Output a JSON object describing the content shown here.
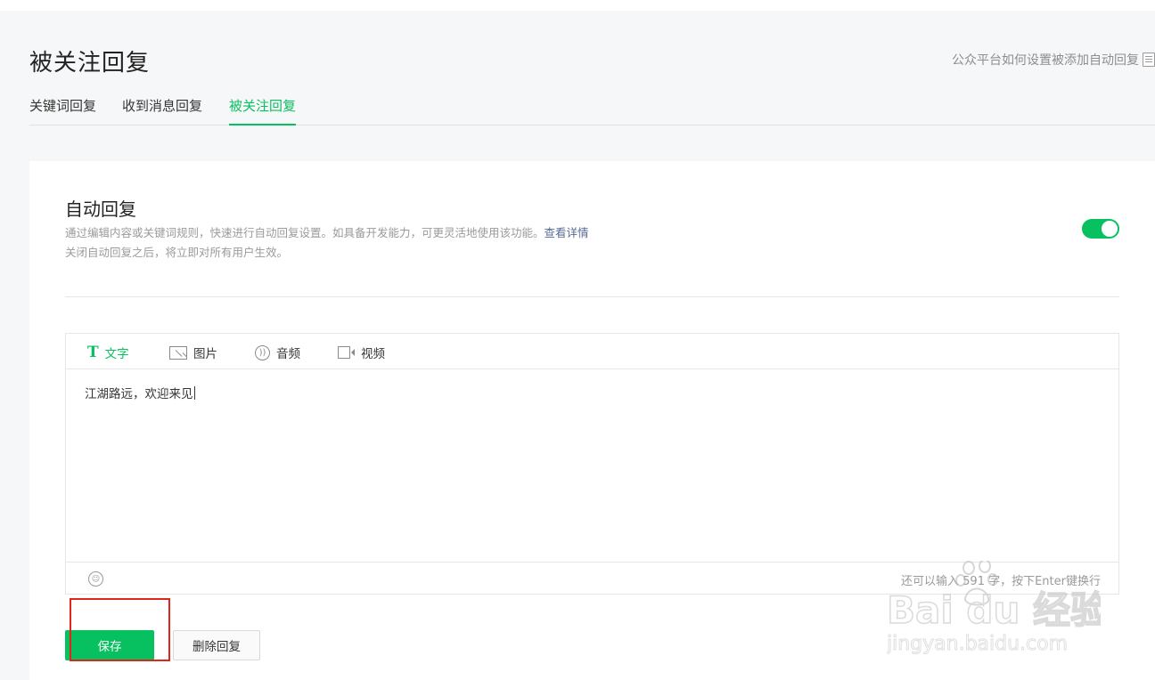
{
  "header": {
    "title": "被关注回复",
    "help_link": "公众平台如何设置被添加自动回复"
  },
  "tabs": [
    {
      "label": "关键词回复",
      "active": false
    },
    {
      "label": "收到消息回复",
      "active": false
    },
    {
      "label": "被关注回复",
      "active": true
    }
  ],
  "autoreply": {
    "title": "自动回复",
    "desc_line1": "通过编辑内容或关键词规则，快速进行自动回复设置。如具备开发能力，可更灵活地使用该功能。",
    "desc_link": "查看详情",
    "desc_line2": "关闭自动回复之后，将立即对所有用户生效。",
    "enabled": true
  },
  "editor": {
    "media_tabs": [
      {
        "label": "文字",
        "icon": "text-icon",
        "active": true
      },
      {
        "label": "图片",
        "icon": "image-icon",
        "active": false
      },
      {
        "label": "音频",
        "icon": "audio-icon",
        "active": false
      },
      {
        "label": "视频",
        "icon": "video-icon",
        "active": false
      }
    ],
    "content": "江湖路远，欢迎来见",
    "counter": "还可以输入 591 字，按下Enter键换行"
  },
  "buttons": {
    "save": "保存",
    "delete": "删除回复"
  },
  "watermark": {
    "brand": "Bai du 经验",
    "url": "jingyan.baidu.com"
  },
  "colors": {
    "accent": "#07c160",
    "link": "#576b95",
    "highlight": "#e0261b"
  }
}
